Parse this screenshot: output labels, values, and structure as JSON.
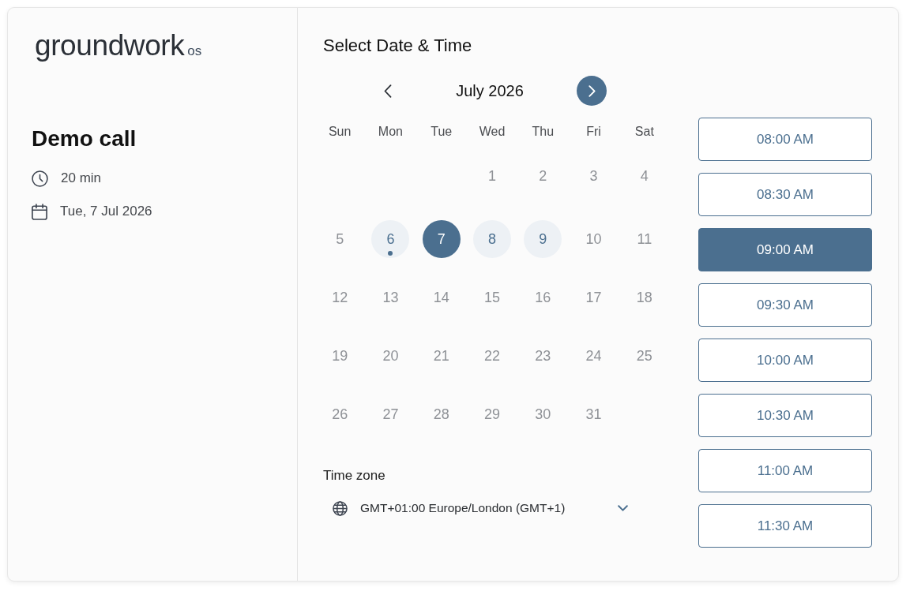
{
  "logo": {
    "wordmark": "groundwork",
    "suffix": "os"
  },
  "event": {
    "title": "Demo call",
    "details": [
      {
        "kind": "duration",
        "text": "20 min"
      },
      {
        "kind": "date",
        "text": "Tue, 7 Jul 2026"
      }
    ]
  },
  "heading": "Select Date & Time",
  "calendar": {
    "month": "July 2026",
    "weekdays": [
      "Sun",
      "Mon",
      "Tue",
      "Wed",
      "Thu",
      "Fri",
      "Sat"
    ],
    "weeks": [
      [
        {
          "day": "1",
          "available": false,
          "selected": false,
          "today": false
        },
        {
          "day": "2",
          "available": false,
          "selected": false,
          "today": false
        },
        {
          "day": "3",
          "available": false,
          "selected": false,
          "today": false
        },
        {
          "day": "4",
          "available": false,
          "selected": false,
          "today": false
        }
      ],
      [
        {
          "day": "5",
          "available": false,
          "selected": false,
          "today": false
        },
        {
          "day": "6",
          "available": true,
          "selected": false,
          "today": true
        },
        {
          "day": "7",
          "available": true,
          "selected": true,
          "today": false
        },
        {
          "day": "8",
          "available": true,
          "selected": false,
          "today": false
        },
        {
          "day": "9",
          "available": true,
          "selected": false,
          "today": false
        },
        {
          "day": "10",
          "available": false,
          "selected": false,
          "today": false
        },
        {
          "day": "11",
          "available": false,
          "selected": false,
          "today": false
        }
      ],
      [
        {
          "day": "12",
          "available": false,
          "selected": false,
          "today": false
        },
        {
          "day": "13",
          "available": false,
          "selected": false,
          "today": false
        },
        {
          "day": "14",
          "available": false,
          "selected": false,
          "today": false
        },
        {
          "day": "15",
          "available": false,
          "selected": false,
          "today": false
        },
        {
          "day": "16",
          "available": false,
          "selected": false,
          "today": false
        },
        {
          "day": "17",
          "available": false,
          "selected": false,
          "today": false
        },
        {
          "day": "18",
          "available": false,
          "selected": false,
          "today": false
        }
      ],
      [
        {
          "day": "19",
          "available": false,
          "selected": false,
          "today": false
        },
        {
          "day": "20",
          "available": false,
          "selected": false,
          "today": false
        },
        {
          "day": "21",
          "available": false,
          "selected": false,
          "today": false
        },
        {
          "day": "22",
          "available": false,
          "selected": false,
          "today": false
        },
        {
          "day": "23",
          "available": false,
          "selected": false,
          "today": false
        },
        {
          "day": "24",
          "available": false,
          "selected": false,
          "today": false
        },
        {
          "day": "25",
          "available": false,
          "selected": false,
          "today": false
        }
      ],
      [
        {
          "day": "26",
          "available": false,
          "selected": false,
          "today": false
        },
        {
          "day": "27",
          "available": false,
          "selected": false,
          "today": false
        },
        {
          "day": "28",
          "available": false,
          "selected": false,
          "today": false
        },
        {
          "day": "29",
          "available": false,
          "selected": false,
          "today": false
        },
        {
          "day": "30",
          "available": false,
          "selected": false,
          "today": false
        },
        {
          "day": "31",
          "available": false,
          "selected": false,
          "today": false
        }
      ]
    ]
  },
  "time_zone": {
    "label": "Time zone",
    "value": "GMT+01:00 Europe/London (GMT+1)"
  },
  "slots": [
    {
      "time": "08:00 AM",
      "selected": false
    },
    {
      "time": "08:30 AM",
      "selected": false
    },
    {
      "time": "09:00 AM",
      "selected": true
    },
    {
      "time": "09:30 AM",
      "selected": false
    },
    {
      "time": "10:00 AM",
      "selected": false
    },
    {
      "time": "10:30 AM",
      "selected": false
    },
    {
      "time": "11:00 AM",
      "selected": false
    },
    {
      "time": "11:30 AM",
      "selected": false
    }
  ]
}
